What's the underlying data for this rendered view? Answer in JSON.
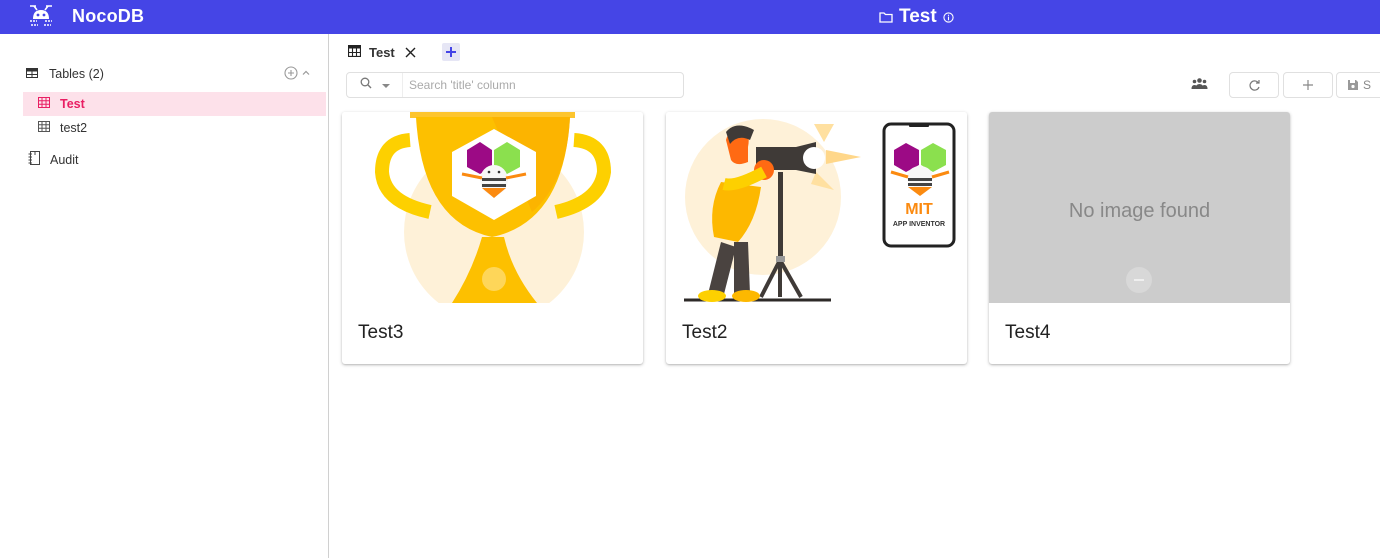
{
  "app": {
    "name": "NocoDB",
    "project_title": "Test",
    "accent_color": "#4545e6",
    "active_color": "#e91e63"
  },
  "sidebar": {
    "tables_header": "Tables (2)",
    "tables": [
      {
        "label": "Test",
        "active": true
      },
      {
        "label": "test2",
        "active": false
      }
    ],
    "audit_label": "Audit"
  },
  "tabs": [
    {
      "label": "Test",
      "icon": "grid-icon",
      "closable": true
    }
  ],
  "toolbar": {
    "search_placeholder": "Search 'title' column",
    "search_value": "",
    "save_label": "S"
  },
  "gallery": {
    "cards": [
      {
        "title": "Test3",
        "image": "trophy-app-inventor"
      },
      {
        "title": "Test2",
        "image": "photographer-app-inventor"
      },
      {
        "title": "Test4",
        "image": null,
        "no_image_text": "No image found"
      }
    ]
  }
}
